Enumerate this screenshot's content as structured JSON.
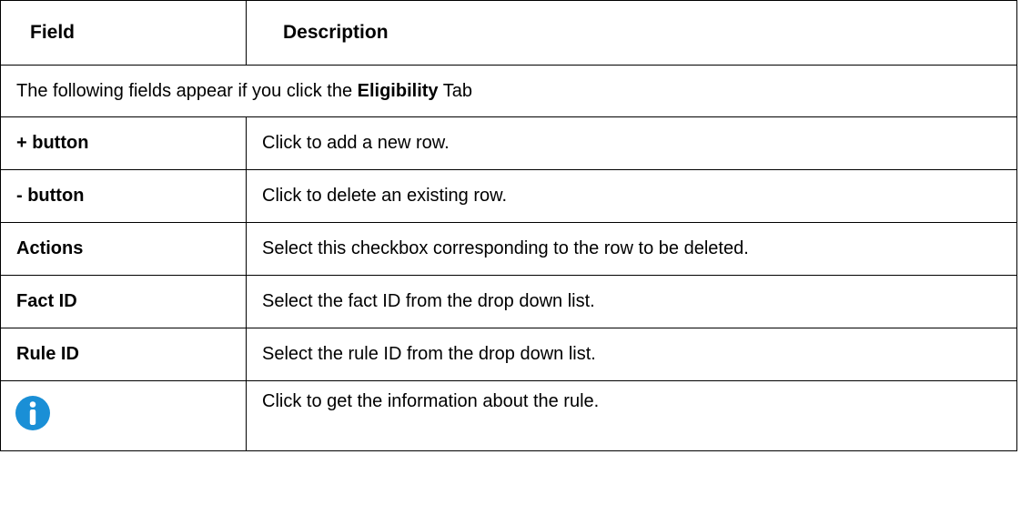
{
  "table": {
    "headers": {
      "field": "Field",
      "description": "Description"
    },
    "note": {
      "before": "The following fields appear if you click the ",
      "bold": "Eligibility",
      "after": " Tab"
    },
    "rows": [
      {
        "field": "+ button",
        "description": "Click to add a new row."
      },
      {
        "field": "- button",
        "description": "Click to delete an existing row."
      },
      {
        "field": "Actions",
        "description": "Select this checkbox corresponding to the row to be deleted."
      },
      {
        "field": "Fact ID",
        "description": "Select the fact ID from the drop down list."
      },
      {
        "field": "Rule ID",
        "description": "Select the rule ID from the drop down list."
      },
      {
        "field_icon": "info-icon",
        "description": "Click to get the information about the rule."
      }
    ]
  },
  "colors": {
    "icon_blue": "#1a8fd6",
    "border": "#000000"
  }
}
